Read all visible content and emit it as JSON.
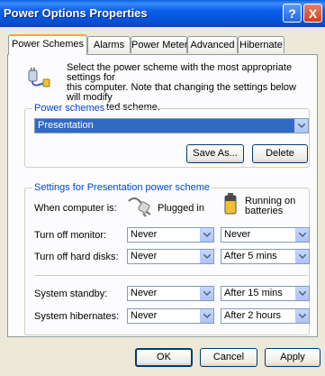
{
  "window": {
    "title": "Power Options Properties",
    "help_glyph": "?",
    "close_glyph": "X"
  },
  "tabs": [
    {
      "label": "Power Schemes",
      "active": true
    },
    {
      "label": "Alarms"
    },
    {
      "label": "Power Meter"
    },
    {
      "label": "Advanced"
    },
    {
      "label": "Hibernate"
    }
  ],
  "intro": {
    "line1": "Select the power scheme with the most appropriate settings for",
    "line2": "this computer. Note that changing the settings below will modify",
    "line3": "the selected scheme."
  },
  "schemes": {
    "group_label": "Power schemes",
    "selected": "Presentation",
    "save_as_label": "Save As...",
    "delete_label": "Delete"
  },
  "settings": {
    "group_label": "Settings for Presentation power scheme",
    "when_label": "When computer is:",
    "plugged_in_label": "Plugged in",
    "batteries_label_1": "Running on",
    "batteries_label_2": "batteries",
    "rows": [
      {
        "label": "Turn off monitor:",
        "plugged": "Never",
        "battery": "Never"
      },
      {
        "label": "Turn off hard disks:",
        "plugged": "Never",
        "battery": "After 5 mins"
      },
      {
        "label": "System standby:",
        "plugged": "Never",
        "battery": "After 15 mins"
      },
      {
        "label": "System hibernates:",
        "plugged": "Never",
        "battery": "After 2 hours"
      }
    ]
  },
  "footer": {
    "ok_label": "OK",
    "cancel_label": "Cancel",
    "apply_label": "Apply"
  }
}
